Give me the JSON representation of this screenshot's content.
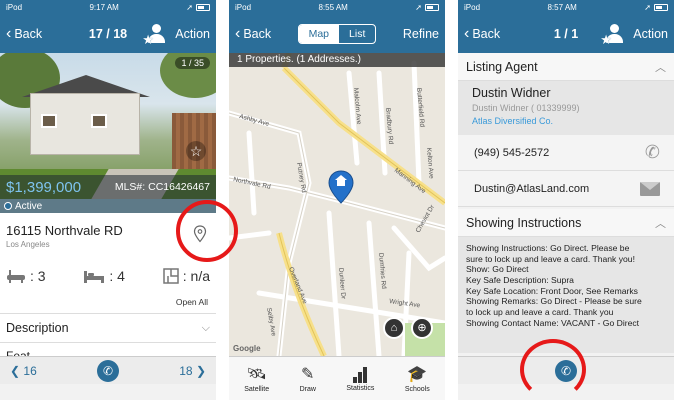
{
  "colors": {
    "nav": "#2b6e99",
    "price": "#7ec3ee",
    "link": "#3a9ad9",
    "highlight": "#e61919"
  },
  "screen1": {
    "status": {
      "carrier": "iPod",
      "time": "9:17 AM"
    },
    "nav": {
      "back": "Back",
      "title": "17 / 18",
      "action": "Action"
    },
    "photo_counter": "1 / 35",
    "price": "$1,399,000",
    "mls": "MLS#: CC16426467",
    "status_label": "Active",
    "address": "16115 Northvale RD",
    "city": "Los Angeles",
    "features": [
      {
        "icon": "bath-icon",
        "value": ": 3"
      },
      {
        "icon": "bed-icon",
        "value": ": 4"
      },
      {
        "icon": "floorplan-icon",
        "value": ": n/a"
      }
    ],
    "open_all": "Open All",
    "description": "Description",
    "features_peek": "Feat",
    "pager": {
      "prev": "16",
      "next": "18"
    }
  },
  "screen2": {
    "status": {
      "carrier": "iPod",
      "time": "8:55 AM"
    },
    "nav": {
      "back": "Back",
      "tab_map": "Map",
      "tab_list": "List",
      "refine": "Refine"
    },
    "properties_text": "1 Properties. (1 Addresses.)",
    "streets": [
      "Ashby Ave",
      "Northvale Rd",
      "Putney Rd",
      "Manning Ave",
      "Overland Ave",
      "Dunleer Dr",
      "Cheviot Dr",
      "Bradbury Rd",
      "Butterfield Rd",
      "Selby Ave",
      "Malcolm Ave",
      "Dumfries Rd",
      "Kelton Ave",
      "Wright Ave"
    ],
    "map_attribution": "Google",
    "tools": [
      {
        "icon": "satellite-icon",
        "label": "Satellite"
      },
      {
        "icon": "draw-icon",
        "label": "Draw"
      },
      {
        "icon": "statistics-icon",
        "label": "Statistics"
      },
      {
        "icon": "schools-icon",
        "label": "Schools"
      }
    ]
  },
  "screen3": {
    "status": {
      "carrier": "iPod",
      "time": "8:57 AM"
    },
    "nav": {
      "back": "Back",
      "title": "1 / 1",
      "action": "Action"
    },
    "listing_agent_header": "Listing Agent",
    "agent_name": "Dustin Widner",
    "agent_sub": "Dustin Widner ( 01339999)",
    "agent_company": "Atlas Diversified Co.",
    "phone": "(949) 545-2572",
    "email": "Dustin@AtlasLand.com",
    "showing_header": "Showing Instructions",
    "showing_lines": [
      "Showing Instructions: Go Direct. Please be",
      "sure to lock up and leave a card. Thank you!",
      "Show: Go Direct",
      "Key Safe Description: Supra",
      "Key Safe Location: Front Door, See Remarks",
      "Showing Remarks: Go Direct - Please be sure",
      "to lock up and leave a card. Thank you",
      "Showing Contact Name: VACANT - Go Direct"
    ]
  }
}
